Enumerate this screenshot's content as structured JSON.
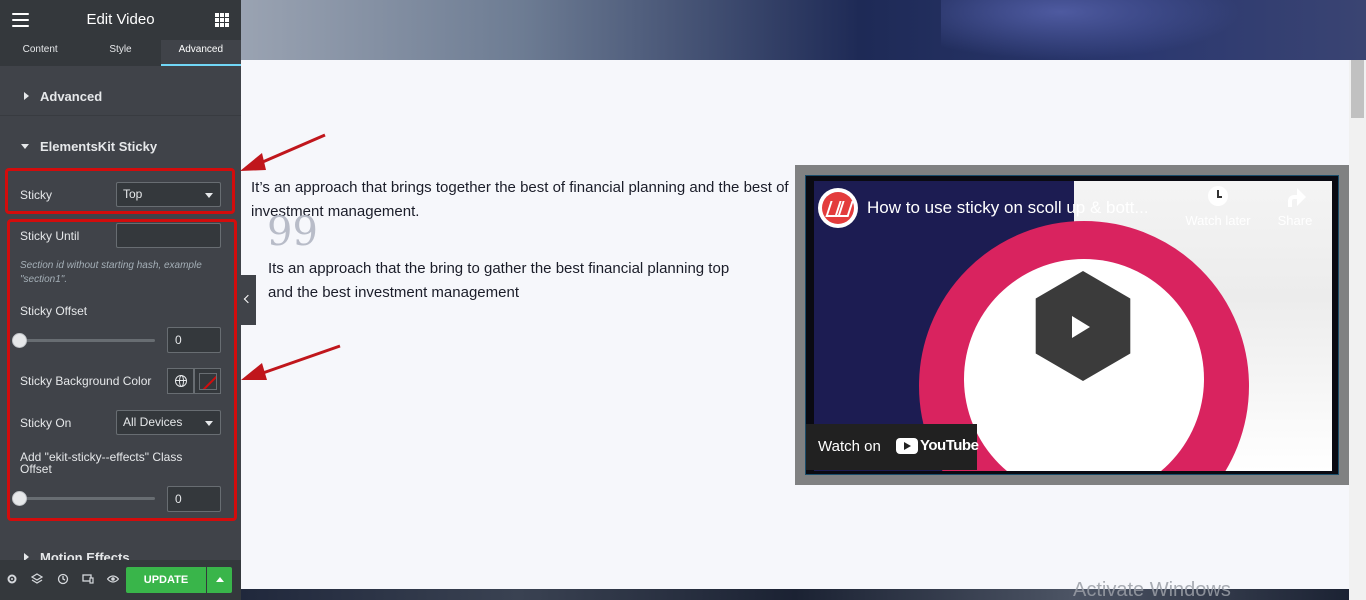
{
  "sidebar": {
    "title": "Edit Video",
    "tabs": [
      "Content",
      "Style",
      "Advanced"
    ],
    "active_tab": "Advanced",
    "sections": {
      "advanced": "Advanced",
      "sticky": "ElementsKit Sticky",
      "motion": "Motion Effects"
    },
    "controls": {
      "sticky_label": "Sticky",
      "sticky_value": "Top",
      "sticky_until_label": "Sticky Until",
      "sticky_until_value": "",
      "help_text": "Section id without starting hash, example \"section1\".",
      "sticky_offset_label": "Sticky Offset",
      "sticky_offset_value": "0",
      "sticky_bg_label": "Sticky Background Color",
      "sticky_on_label": "Sticky On",
      "sticky_on_value": "All Devices",
      "class_offset_label": "Add \"ekit-sticky--effects\" Class Offset",
      "class_offset_value": "0"
    },
    "footer": {
      "update_label": "UPDATE",
      "icons": [
        "gear-icon",
        "layers-icon",
        "history-icon",
        "responsive-icon",
        "eye-icon"
      ]
    }
  },
  "content": {
    "paragraph1": "It’s an approach that brings together the best of financial planning and the best of investment management.",
    "quote_mark": "99",
    "paragraph2": "Its an approach that the bring to gather the best financial planning top and the best investment management"
  },
  "video": {
    "title": "How to use sticky on scoll up & bott...",
    "watch_later": "Watch later",
    "share": "Share",
    "watch_on": "Watch on",
    "youtube": "YouTube"
  },
  "watermark": "Activate Windows",
  "colors": {
    "panel_bg": "#404349",
    "header_bg": "#34383c",
    "accent_tab": "#71d7f7",
    "update_green": "#39b54a",
    "highlight_red": "#d30c0c",
    "video_pink": "#d9235f"
  }
}
